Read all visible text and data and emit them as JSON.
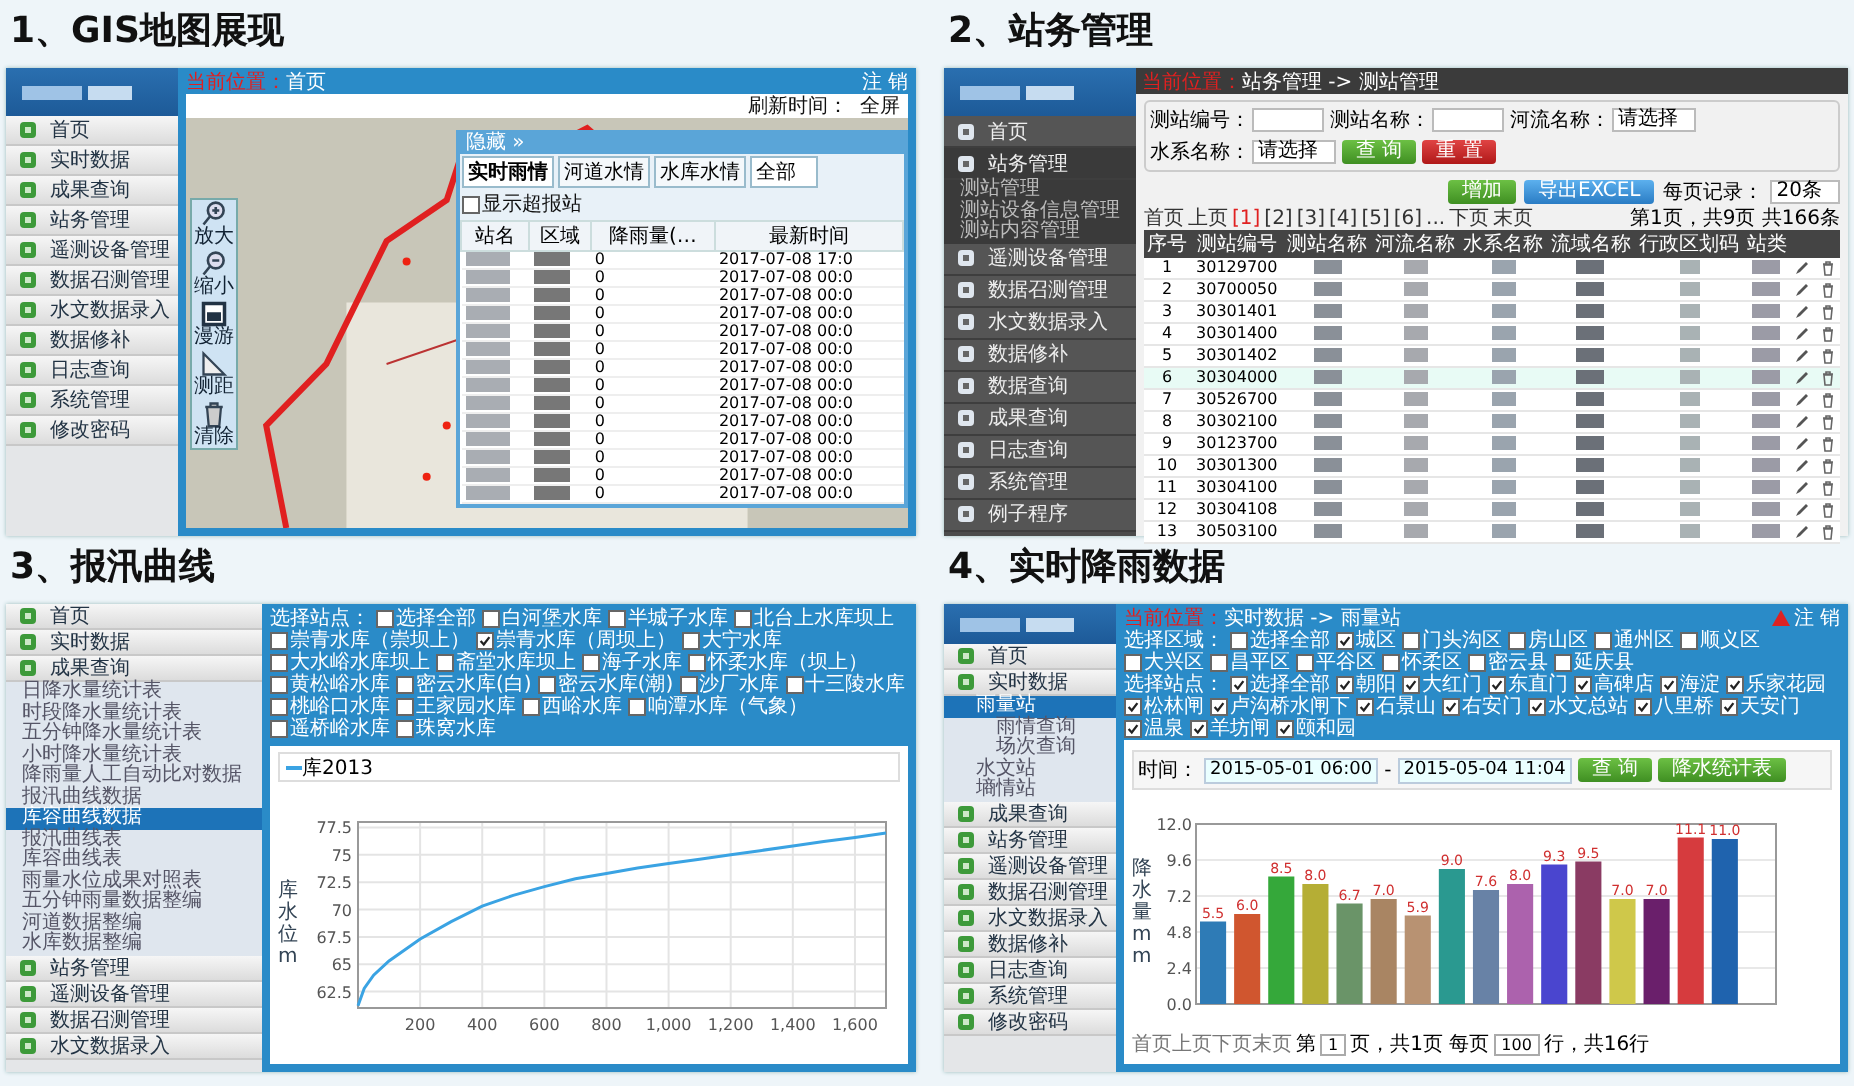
{
  "gis": {
    "title": "1、GIS地图展现",
    "sidebar": [
      {
        "label": "首页",
        "selected": false
      },
      {
        "label": "实时数据",
        "selected": false
      },
      {
        "label": "成果查询",
        "selected": false
      },
      {
        "label": "站务管理",
        "selected": false
      },
      {
        "label": "遥测设备管理",
        "selected": false
      },
      {
        "label": "数据召测管理",
        "selected": false
      },
      {
        "label": "水文数据录入",
        "selected": false
      },
      {
        "label": "数据修补",
        "selected": false
      },
      {
        "label": "日志查询",
        "selected": false
      },
      {
        "label": "系统管理",
        "selected": false
      },
      {
        "label": "修改密码",
        "selected": false
      }
    ],
    "breadcrumb_label": "当前位置：",
    "breadcrumb": "首页",
    "logout": "注 销",
    "refresh_label": "刷新时间：",
    "fullscreen": "全屏",
    "tools": [
      {
        "kind": "zoom_in",
        "label": "放大"
      },
      {
        "kind": "zoom_out",
        "label": "缩小"
      },
      {
        "kind": "pan",
        "label": "漫游"
      },
      {
        "kind": "measure",
        "label": "测距"
      },
      {
        "kind": "clear",
        "label": "清除"
      }
    ],
    "popup": {
      "title": "隐藏 »",
      "tabs": [
        {
          "label": "实时雨情",
          "selected": true
        },
        {
          "label": "河道水情",
          "selected": false
        },
        {
          "label": "水库水情",
          "selected": false
        }
      ],
      "filter": "全部",
      "option": {
        "label": "显示超报站",
        "checked": false
      },
      "columns": [
        "站名",
        "区域",
        "降雨量(…",
        "最新时间"
      ],
      "rows": [
        {
          "rain": "0",
          "time": "2017-07-08 17:0"
        },
        {
          "rain": "0",
          "time": "2017-07-08 00:0"
        },
        {
          "rain": "0",
          "time": "2017-07-08 00:0"
        },
        {
          "rain": "0",
          "time": "2017-07-08 00:0"
        },
        {
          "rain": "0",
          "time": "2017-07-08 00:0"
        },
        {
          "rain": "0",
          "time": "2017-07-08 00:0"
        },
        {
          "rain": "0",
          "time": "2017-07-08 00:0"
        },
        {
          "rain": "0",
          "time": "2017-07-08 00:0"
        },
        {
          "rain": "0",
          "time": "2017-07-08 00:0"
        },
        {
          "rain": "0",
          "time": "2017-07-08 00:0"
        },
        {
          "rain": "0",
          "time": "2017-07-08 00:0"
        },
        {
          "rain": "0",
          "time": "2017-07-08 00:0"
        },
        {
          "rain": "0",
          "time": "2017-07-08 00:0"
        },
        {
          "rain": "0",
          "time": "2017-07-08 00:0"
        }
      ]
    }
  },
  "station": {
    "title": "2、站务管理",
    "sidebar": [
      {
        "label": "首页",
        "selected": false
      },
      {
        "label": "站务管理",
        "selected": true,
        "children": [
          {
            "label": "测站管理",
            "selected": false
          },
          {
            "label": "测站设备信息管理",
            "selected": false
          },
          {
            "label": "测站内容管理",
            "selected": false
          }
        ]
      },
      {
        "label": "遥测设备管理",
        "selected": false
      },
      {
        "label": "数据召测管理",
        "selected": false
      },
      {
        "label": "水文数据录入",
        "selected": false
      },
      {
        "label": "数据修补",
        "selected": false
      },
      {
        "label": "数据查询",
        "selected": false
      },
      {
        "label": "成果查询",
        "selected": false
      },
      {
        "label": "日志查询",
        "selected": false
      },
      {
        "label": "系统管理",
        "selected": false
      },
      {
        "label": "例子程序",
        "selected": false
      }
    ],
    "breadcrumb_label": "当前位置：",
    "breadcrumb": "站务管理 -> 测站管理",
    "fields": [
      {
        "label": "测站编号：",
        "kind": "text"
      },
      {
        "label": "测站名称：",
        "kind": "text"
      },
      {
        "label": "河流名称：",
        "kind": "select",
        "value": "请选择"
      },
      {
        "label": "水系名称：",
        "kind": "select",
        "value": "请选择"
      }
    ],
    "query": "查 询",
    "reset": "重 置",
    "add": "增加",
    "export": "导出EXCEL",
    "page_size_label": "每页记录：",
    "page_size": "20条",
    "pager": [
      {
        "label": "首页",
        "selected": false
      },
      {
        "label": "上页",
        "selected": false
      },
      {
        "label": "[1]",
        "selected": true
      },
      {
        "label": "[2]",
        "selected": false
      },
      {
        "label": "[3]",
        "selected": false
      },
      {
        "label": "[4]",
        "selected": false
      },
      {
        "label": "[5]",
        "selected": false
      },
      {
        "label": "[6]",
        "selected": false
      },
      {
        "label": "...",
        "selected": false
      },
      {
        "label": "下页",
        "selected": false
      },
      {
        "label": "末页",
        "selected": false
      }
    ],
    "page_info": "第1页，共9页 共166条",
    "columns": [
      "序号",
      "测站编号",
      "测站名称",
      "河流名称",
      "水系名称",
      "流域名称",
      "行政区划码",
      "站类"
    ],
    "rows": [
      {
        "no": "1",
        "code": "30129700",
        "selected": false
      },
      {
        "no": "2",
        "code": "30700050",
        "selected": false
      },
      {
        "no": "3",
        "code": "30301401",
        "selected": false
      },
      {
        "no": "4",
        "code": "30301400",
        "selected": false
      },
      {
        "no": "5",
        "code": "30301402",
        "selected": false
      },
      {
        "no": "6",
        "code": "30304000",
        "selected": true
      },
      {
        "no": "7",
        "code": "30526700",
        "selected": false
      },
      {
        "no": "8",
        "code": "30302100",
        "selected": false
      },
      {
        "no": "9",
        "code": "30123700",
        "selected": false
      },
      {
        "no": "10",
        "code": "30301300",
        "selected": false
      },
      {
        "no": "11",
        "code": "30304100",
        "selected": false
      },
      {
        "no": "12",
        "code": "30304108",
        "selected": false
      },
      {
        "no": "13",
        "code": "30503100",
        "selected": false
      }
    ]
  },
  "curve": {
    "title": "3、报汛曲线",
    "sidebar": [
      {
        "label": "首页",
        "selected": false
      },
      {
        "label": "实时数据",
        "selected": false
      },
      {
        "label": "成果查询",
        "selected": false,
        "children": [
          {
            "label": "日降水量统计表",
            "selected": false
          },
          {
            "label": "时段降水量统计表",
            "selected": false
          },
          {
            "label": "五分钟降水量统计表",
            "selected": false
          },
          {
            "label": "小时降水量统计表",
            "selected": false
          },
          {
            "label": "降雨量人工自动比对数据",
            "selected": false
          },
          {
            "label": "报汛曲线数据",
            "selected": false
          },
          {
            "label": "库容曲线数据",
            "selected": true
          },
          {
            "label": "报汛曲线表",
            "selected": false
          },
          {
            "label": "库容曲线表",
            "selected": false
          },
          {
            "label": "雨量水位成果对照表",
            "selected": false
          },
          {
            "label": "五分钟雨量数据整编",
            "selected": false
          },
          {
            "label": "河道数据整编",
            "selected": false
          },
          {
            "label": "水库数据整编",
            "selected": false
          }
        ]
      },
      {
        "label": "站务管理",
        "selected": false
      },
      {
        "label": "遥测设备管理",
        "selected": false
      },
      {
        "label": "数据召测管理",
        "selected": false
      },
      {
        "label": "水文数据录入",
        "selected": false
      }
    ],
    "station_label": "选择站点：",
    "stations": [
      {
        "label": "选择全部",
        "checked": false
      },
      {
        "label": "白河堡水库",
        "checked": false
      },
      {
        "label": "半城子水库",
        "checked": false
      },
      {
        "label": "北台上水库坝上",
        "checked": false
      },
      {
        "label": "崇青水库（崇坝上）",
        "checked": false
      },
      {
        "label": "崇青水库（周坝上）",
        "checked": true
      },
      {
        "label": "大宁水库",
        "checked": false
      },
      {
        "label": "大水峪水库坝上",
        "checked": false
      },
      {
        "label": "斋堂水库坝上",
        "checked": false
      },
      {
        "label": "海子水库",
        "checked": false
      },
      {
        "label": "怀柔水库（坝上）",
        "checked": false
      },
      {
        "label": "黄松峪水库",
        "checked": false
      },
      {
        "label": "密云水库(白)",
        "checked": false
      },
      {
        "label": "密云水库(潮)",
        "checked": false
      },
      {
        "label": "沙厂水库",
        "checked": false
      },
      {
        "label": "十三陵水库",
        "checked": false
      },
      {
        "label": "桃峪口水库",
        "checked": false
      },
      {
        "label": "王家园水库",
        "checked": false
      },
      {
        "label": "西峪水库",
        "checked": false
      },
      {
        "label": "响潭水库（气象）",
        "checked": false
      },
      {
        "label": "遥桥峪水库",
        "checked": false
      },
      {
        "label": "珠窝水库",
        "checked": false
      }
    ],
    "chart_data": {
      "type": "line",
      "ylabel": "库水位m",
      "grid": true,
      "xlim": [
        0,
        1700
      ],
      "ylim": [
        61,
        78
      ],
      "xticks": [
        200,
        400,
        600,
        800,
        {
          "value": 1000,
          "label": "1,000"
        },
        {
          "value": 1200,
          "label": "1,200"
        },
        {
          "value": 1400,
          "label": "1,400"
        },
        {
          "value": 1600,
          "label": "1,600"
        }
      ],
      "yticks": [
        62.5,
        65,
        67.5,
        70,
        72.5,
        75,
        77.5
      ],
      "x": [
        0,
        20,
        50,
        100,
        200,
        300,
        400,
        500,
        600,
        700,
        800,
        900,
        1000,
        1100,
        1200,
        1300,
        1400,
        1500,
        1600,
        1700
      ],
      "series": [
        {
          "name": "库2013",
          "color": "#3aa3e3",
          "values": [
            61.2,
            62.8,
            64,
            65.3,
            67.3,
            68.9,
            70.3,
            71.3,
            72.1,
            72.8,
            73.3,
            73.8,
            74.2,
            74.6,
            75,
            75.4,
            75.8,
            76.2,
            76.6,
            77
          ]
        }
      ]
    }
  },
  "rain": {
    "title": "4、实时降雨数据",
    "sidebar": [
      {
        "label": "首页",
        "selected": false
      },
      {
        "label": "实时数据",
        "selected": false,
        "children": [
          {
            "label": "雨量站",
            "selected": true,
            "children": [
              {
                "label": "雨情查询",
                "selected": false
              },
              {
                "label": "场次查询",
                "selected": false
              }
            ]
          },
          {
            "label": "水文站",
            "selected": false
          },
          {
            "label": "墒情站",
            "selected": false
          }
        ]
      },
      {
        "label": "成果查询",
        "selected": false
      },
      {
        "label": "站务管理",
        "selected": false
      },
      {
        "label": "遥测设备管理",
        "selected": false
      },
      {
        "label": "数据召测管理",
        "selected": false
      },
      {
        "label": "水文数据录入",
        "selected": false
      },
      {
        "label": "数据修补",
        "selected": false
      },
      {
        "label": "日志查询",
        "selected": false
      },
      {
        "label": "系统管理",
        "selected": false
      },
      {
        "label": "修改密码",
        "selected": false
      }
    ],
    "breadcrumb_label": "当前位置：",
    "breadcrumb": "实时数据 -> 雨量站",
    "logout": "注 销",
    "region_label": "选择区域：",
    "regions": [
      {
        "label": "选择全部",
        "checked": false
      },
      {
        "label": "城区",
        "checked": true
      },
      {
        "label": "门头沟区",
        "checked": false
      },
      {
        "label": "房山区",
        "checked": false
      },
      {
        "label": "通州区",
        "checked": false
      },
      {
        "label": "顺义区",
        "checked": false
      },
      {
        "label": "大兴区",
        "checked": false
      },
      {
        "label": "昌平区",
        "checked": false
      },
      {
        "label": "平谷区",
        "checked": false
      },
      {
        "label": "怀柔区",
        "checked": false
      },
      {
        "label": "密云县",
        "checked": false
      },
      {
        "label": "延庆县",
        "checked": false
      }
    ],
    "station_label": "选择站点：",
    "stations": [
      {
        "label": "选择全部",
        "checked": true
      },
      {
        "label": "朝阳",
        "checked": true
      },
      {
        "label": "大红门",
        "checked": true
      },
      {
        "label": "东直门",
        "checked": true
      },
      {
        "label": "高碑店",
        "checked": true
      },
      {
        "label": "海淀",
        "checked": true
      },
      {
        "label": "乐家花园",
        "checked": true
      },
      {
        "label": "松林闸",
        "checked": true
      },
      {
        "label": "卢沟桥水闸下",
        "checked": true
      },
      {
        "label": "石景山",
        "checked": true
      },
      {
        "label": "右安门",
        "checked": true
      },
      {
        "label": "水文总站",
        "checked": true
      },
      {
        "label": "八里桥",
        "checked": true
      },
      {
        "label": "天安门",
        "checked": true
      },
      {
        "label": "温泉",
        "checked": true
      },
      {
        "label": "羊坊闸",
        "checked": true
      },
      {
        "label": "颐和园",
        "checked": true
      }
    ],
    "time_label": "时间：",
    "start": "2015-05-01 06:00",
    "separator": "-",
    "end": "2015-05-04 11:04",
    "query": "查 询",
    "stats": "降水统计表",
    "chart_data": {
      "type": "bar",
      "ylabel": "降水量mm",
      "grid": true,
      "ylim": [
        0,
        12
      ],
      "yticks": [
        {
          "value": 0,
          "label": "0.0"
        },
        {
          "value": 2.4,
          "label": "2.4"
        },
        {
          "value": 4.8,
          "label": "4.8"
        },
        {
          "value": 7.2,
          "label": "7.2"
        },
        {
          "value": 9.6,
          "label": "9.6"
        },
        {
          "value": 12,
          "label": "12.0"
        }
      ],
      "series": [
        {
          "values": [
            5.5,
            6.0,
            8.5,
            8.0,
            6.7,
            7.0,
            5.9,
            9.0,
            7.6,
            8.0,
            9.3,
            9.5,
            7.0,
            7.0,
            11.1,
            11.0,
            null
          ]
        }
      ],
      "value_labels": [
        "5.5",
        "6.0",
        "8.5",
        "8.0",
        "6.7",
        "7.0",
        "5.9",
        "9.0",
        "7.6",
        "8.0",
        "9.3",
        "9.5",
        "7.0",
        "7.0",
        "11.1",
        "11.0",
        null
      ]
    },
    "pager_links": "首页上页下页末页",
    "page_label": "第",
    "page": "1",
    "page_total": "页，共1页 每页",
    "page_size": "100",
    "count": "行，共16行"
  }
}
